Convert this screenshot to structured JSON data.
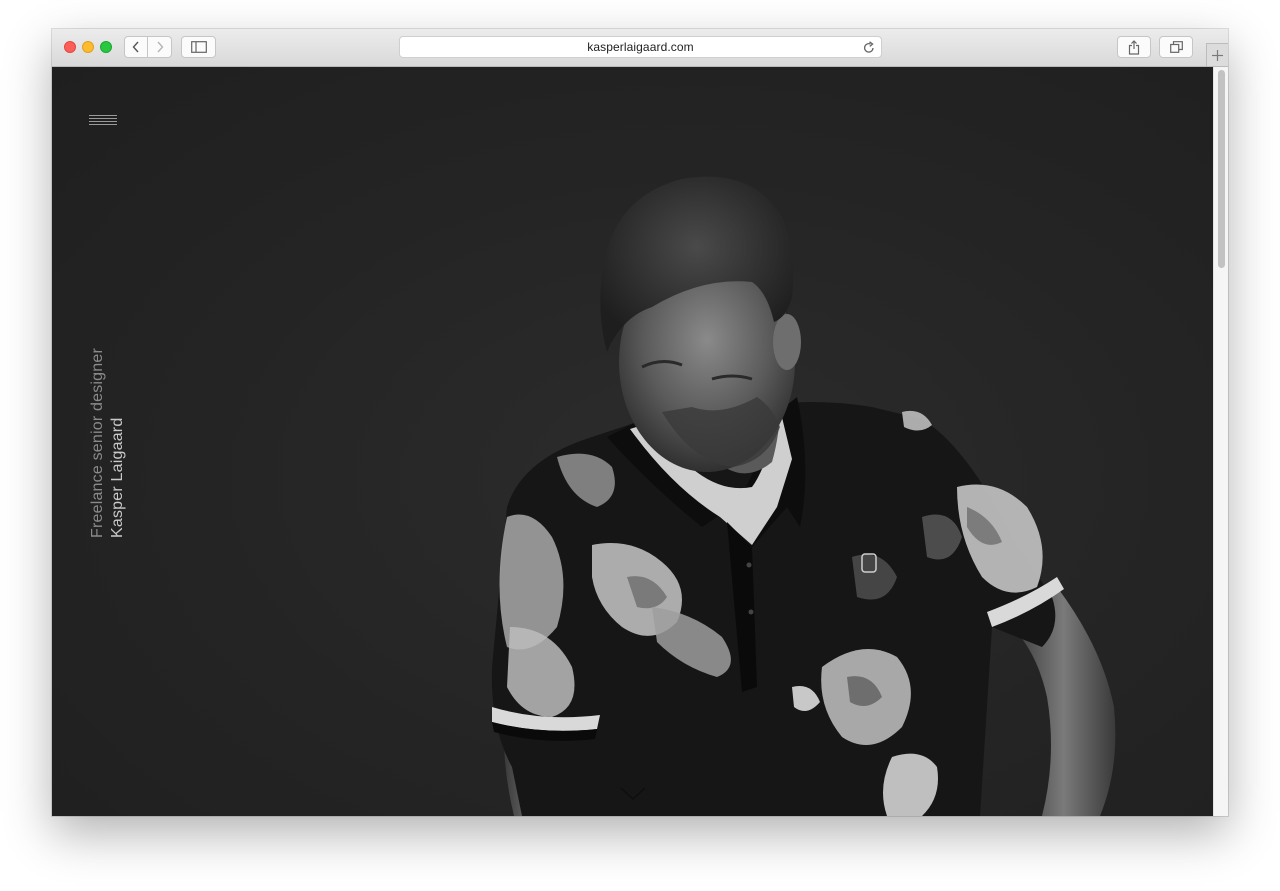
{
  "browser": {
    "url": "kasperlaigaard.com",
    "icons": {
      "back": "chevron-left-icon",
      "forward": "chevron-right-icon",
      "sidebar": "sidebar-icon",
      "reload": "reload-icon",
      "share": "share-icon",
      "tabs": "tabs-overview-icon",
      "new_tab": "plus-icon"
    }
  },
  "page": {
    "menu_icon": "hamburger-menu-icon",
    "intro": {
      "role": "Freelance senior designer",
      "name": "Kasper Laigaard"
    },
    "hero_image": "black-and-white portrait photo",
    "scroll_icon": "chevron-down-icon"
  },
  "colors": {
    "page_background": "#232323",
    "role_text": "#8a8a8a",
    "name_text": "#c9c9c9"
  }
}
